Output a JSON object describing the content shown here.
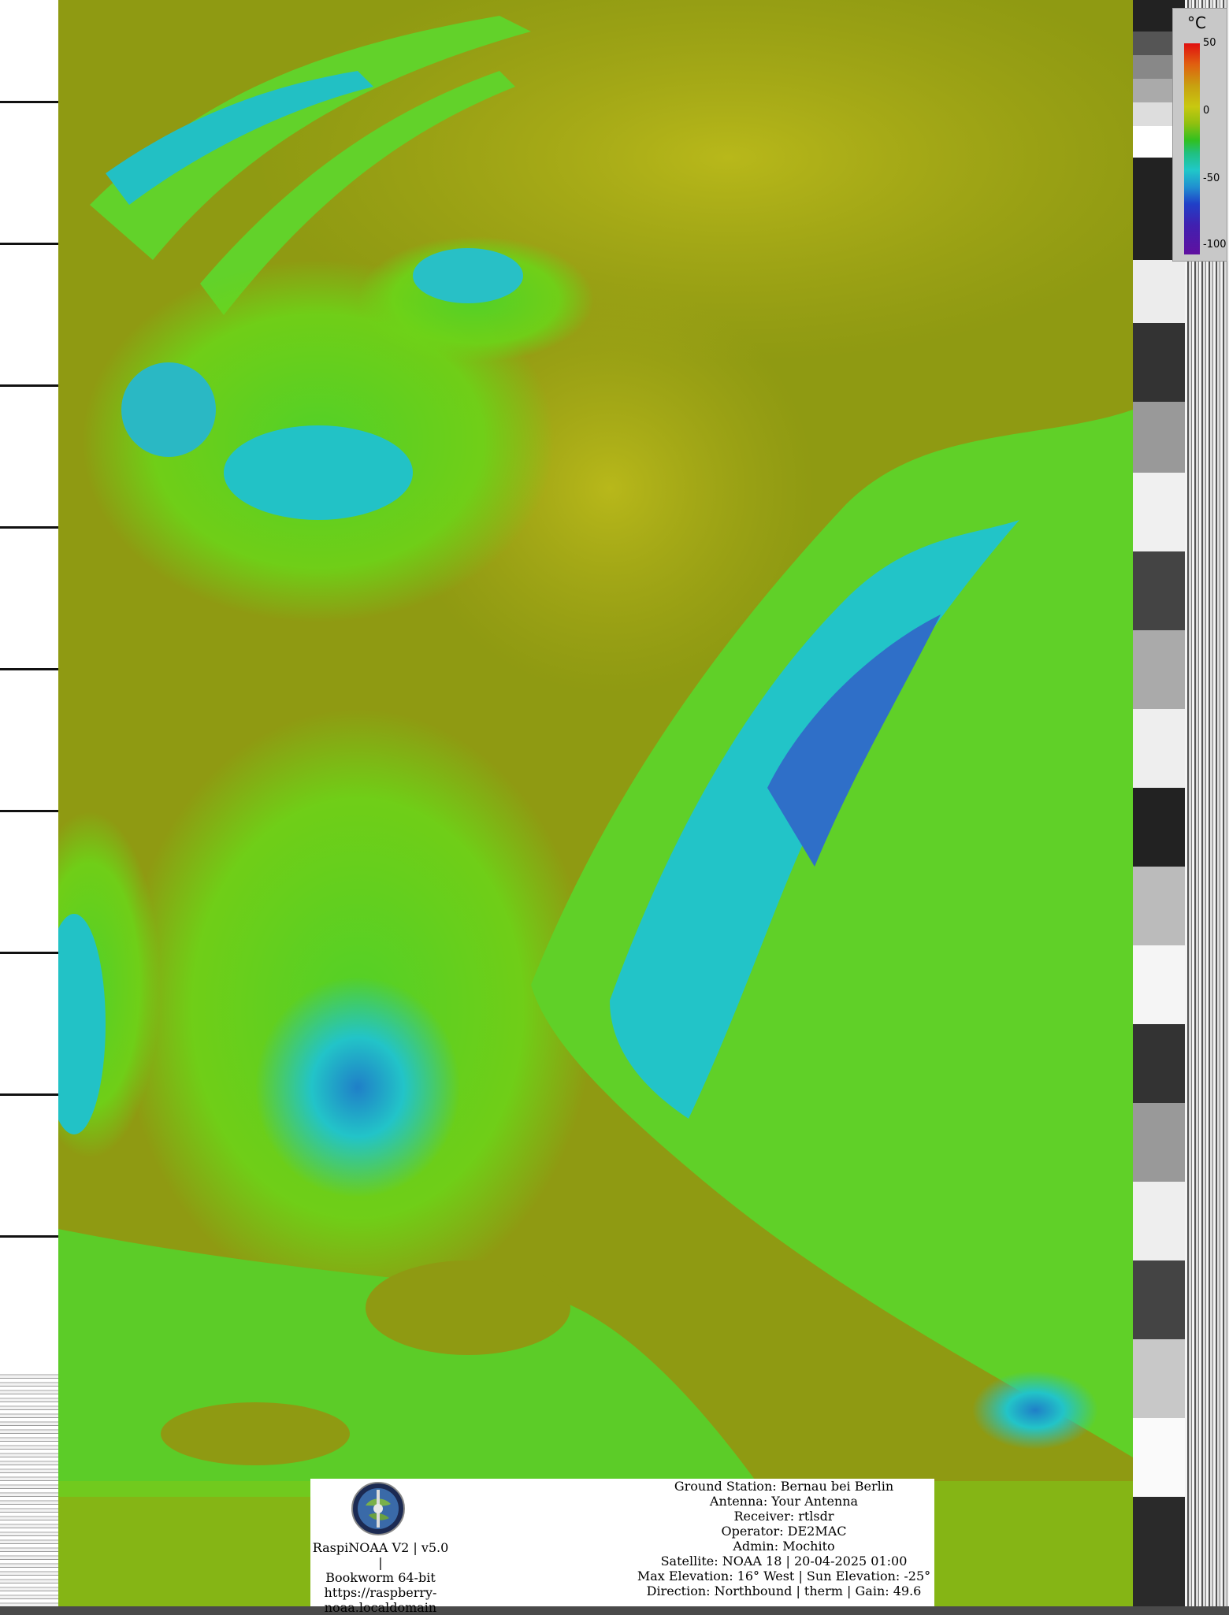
{
  "legend": {
    "unit": "°C",
    "labels": [
      "50",
      "0",
      "-50",
      "-100"
    ]
  },
  "station_block": {
    "logo": "raspinoaa-logo",
    "lines": [
      "RaspiNOAA V2 | v5.0 |",
      "Bookworm 64-bit",
      "https://raspberry-",
      "noaa.localdomain"
    ]
  },
  "metadata": {
    "lines": [
      "Ground Station: Bernau bei Berlin",
      "Antenna: Your Antenna",
      "Receiver: rtlsdr",
      "Operator: DE2MAC",
      "Admin: Mochito",
      "Satellite: NOAA 18 | 20-04-2025 01:00",
      "Max Elevation: 16° West | Sun Elevation: -25°",
      "Direction: Northbound | therm | Gain: 49.6"
    ]
  },
  "colors": {
    "warm_surface": "#8f9a12",
    "mid_cloud": "#5fd020",
    "cold_cloud": "#20c8c8",
    "coldest_cloud": "#2a5ad0"
  }
}
